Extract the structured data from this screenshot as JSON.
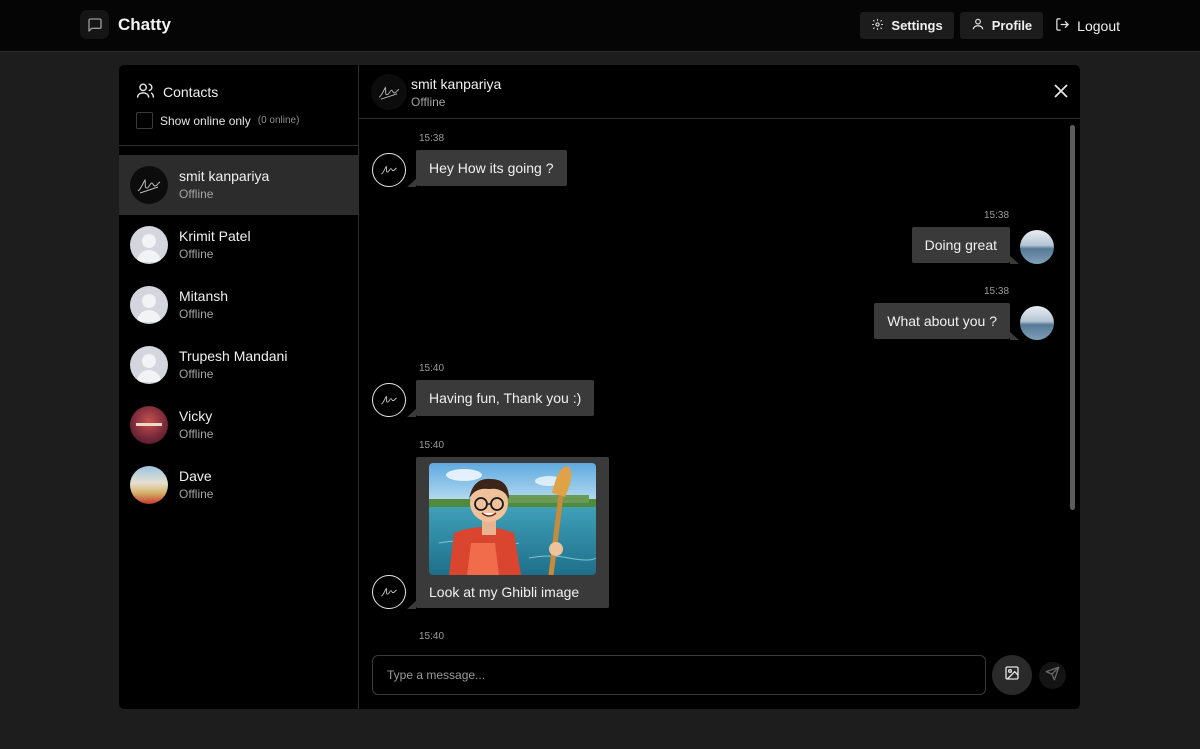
{
  "app": {
    "name": "Chatty",
    "logo_icon": "message-square-icon"
  },
  "nav": {
    "settings_label": "Settings",
    "profile_label": "Profile",
    "logout_label": "Logout"
  },
  "sidebar": {
    "title": "Contacts",
    "show_online_label": "Show online only",
    "online_count": "(0 online)",
    "contacts": [
      {
        "name": "smit kanpariya",
        "status": "Offline",
        "avatar": "signature"
      },
      {
        "name": "Krimit Patel",
        "status": "Offline",
        "avatar": "default"
      },
      {
        "name": "Mitansh",
        "status": "Offline",
        "avatar": "default"
      },
      {
        "name": "Trupesh Mandani",
        "status": "Offline",
        "avatar": "default"
      },
      {
        "name": "Vicky",
        "status": "Offline",
        "avatar": "photo"
      },
      {
        "name": "Dave",
        "status": "Offline",
        "avatar": "photo"
      }
    ]
  },
  "chat": {
    "contact_name": "smit kanpariya",
    "contact_status": "Offline",
    "messages": [
      {
        "time": "15:38",
        "text": "Hey How its going ?",
        "from": "them"
      },
      {
        "time": "15:38",
        "text": "Doing great",
        "from": "me"
      },
      {
        "time": "15:38",
        "text": "What about you ?",
        "from": "me"
      },
      {
        "time": "15:40",
        "text": "Having fun, Thank you :)",
        "from": "them"
      },
      {
        "time": "15:40",
        "text": "Look at my Ghibli image",
        "from": "them",
        "has_image": true
      },
      {
        "time": "15:40",
        "text": "",
        "from": "them"
      }
    ],
    "composer_placeholder": "Type a message..."
  },
  "colors": {
    "page_bg": "#1d1d1d",
    "panel_bg": "#000000",
    "bubble_bg": "#3a3a3a",
    "active_contact_bg": "#2c2c2c"
  }
}
